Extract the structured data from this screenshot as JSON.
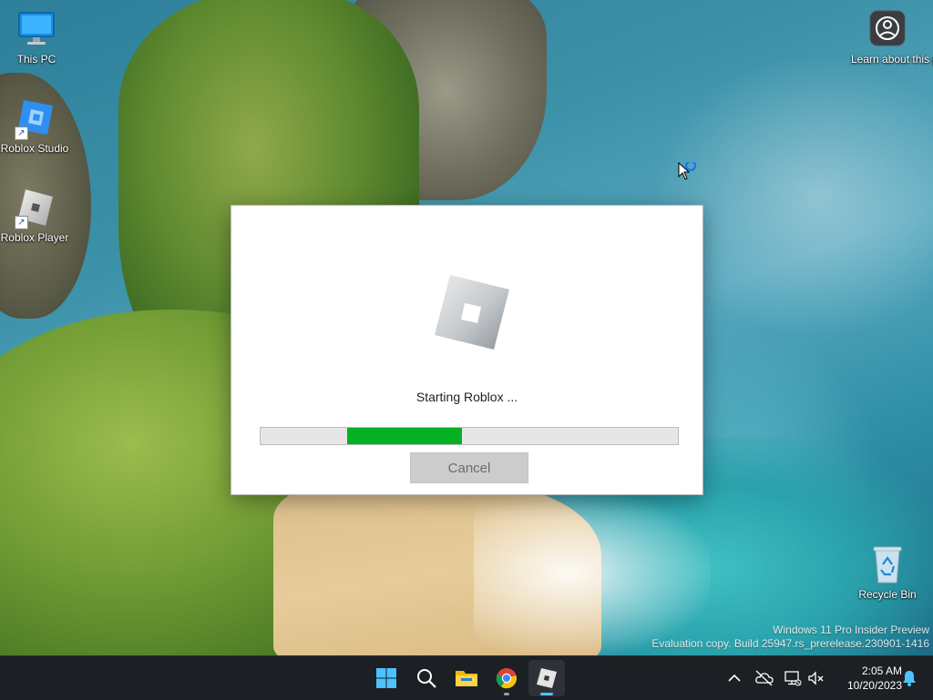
{
  "desktop": {
    "icons": [
      {
        "label": "This PC"
      },
      {
        "label": "Roblox Studio"
      },
      {
        "label": "Roblox Player"
      },
      {
        "label": "Recycle Bin"
      }
    ],
    "spotlight": {
      "label": "Learn about this picture"
    },
    "watermark": {
      "line1": "Windows 11 Pro Insider Preview",
      "line2": "Evaluation copy. Build 25947.rs_prerelease.230901-1416"
    }
  },
  "dialog": {
    "status_text": "Starting Roblox ...",
    "progress": {
      "start_fraction": 0.207,
      "end_fraction": 0.483,
      "color": "#06b025"
    },
    "cancel_label": "Cancel"
  },
  "taskbar": {
    "apps": [
      {
        "name": "start",
        "icon": "windows-logo-icon"
      },
      {
        "name": "search",
        "icon": "search-icon"
      },
      {
        "name": "file-explorer",
        "icon": "folder-icon"
      },
      {
        "name": "chrome",
        "icon": "chrome-icon"
      },
      {
        "name": "roblox",
        "icon": "roblox-icon",
        "active": true
      }
    ],
    "tray": {
      "time": "2:05 AM",
      "date": "10/20/2023"
    }
  }
}
